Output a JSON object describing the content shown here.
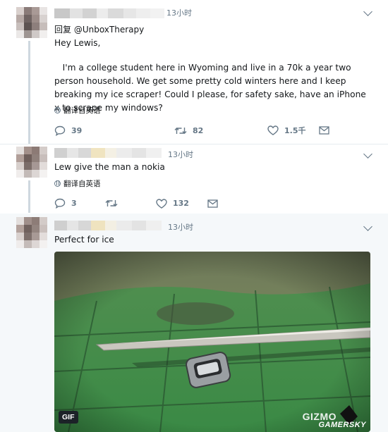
{
  "tweets": [
    {
      "time": "13小时",
      "reply_to": "回复 @UnboxTherapy",
      "greeting": "Hey Lewis,",
      "text": "   I'm a college student here in Wyoming and live in a 70k a year two person household. We get some pretty cold winters here and I keep breaking my ice scraper! Could I please, for safety sake, have an iPhone x to scrape my windows?",
      "translate": "翻译自英语",
      "replies": "39",
      "retweets": "82",
      "likes": "1.5千"
    },
    {
      "time": "13小时",
      "text": "Lew give the man a nokia",
      "translate": "翻译自英语",
      "replies": "3",
      "retweets": "",
      "likes": "132"
    },
    {
      "time": "13小时",
      "text": "Perfect for ice",
      "media_badge": "GIF",
      "watermark": "GIZMO",
      "watermark2": "GAMERSKY"
    }
  ],
  "colors": {
    "text": "#14171a",
    "secondary": "#657786",
    "thread_line": "#cfd8df"
  },
  "icons": [
    "chevron-down-icon",
    "globe-icon",
    "reply-icon",
    "retweet-icon",
    "like-icon",
    "message-icon"
  ]
}
